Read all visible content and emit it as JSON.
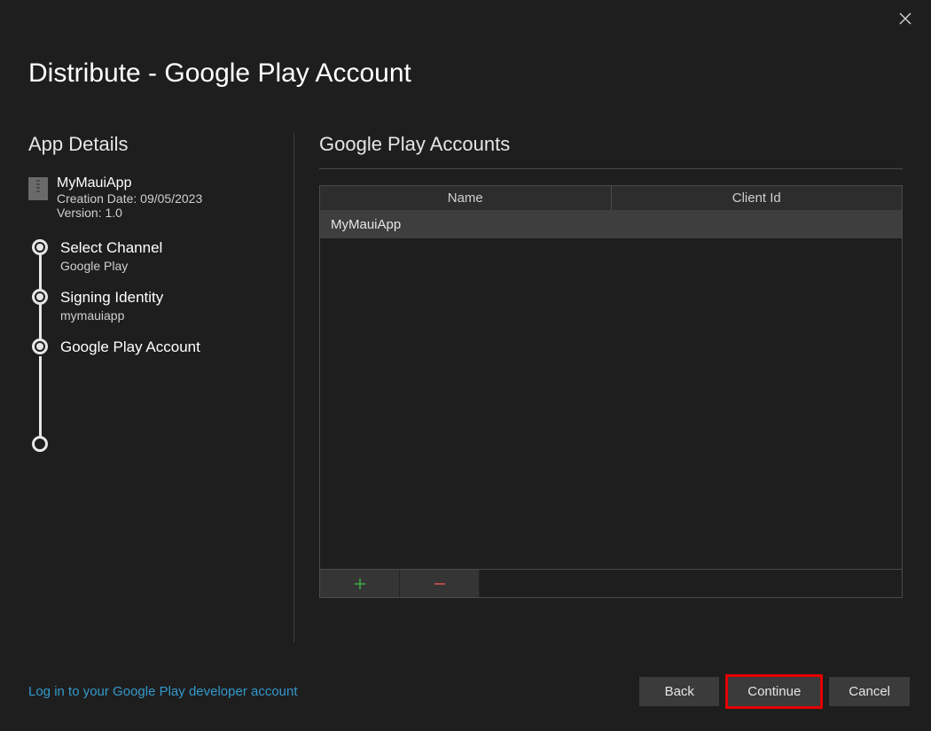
{
  "window": {
    "title": "Distribute - Google Play Account"
  },
  "sidebar": {
    "title": "App Details",
    "app": {
      "name": "MyMauiApp",
      "creation_line": "Creation Date: 09/05/2023",
      "version_line": "Version: 1.0"
    },
    "steps": [
      {
        "label": "Select Channel",
        "sub": "Google Play"
      },
      {
        "label": "Signing Identity",
        "sub": "mymauiapp"
      },
      {
        "label": "Google Play Account",
        "sub": ""
      }
    ]
  },
  "main": {
    "title": "Google Play Accounts",
    "columns": {
      "name": "Name",
      "client_id": "Client Id"
    },
    "rows": [
      {
        "name": "MyMauiApp",
        "client_id": ""
      }
    ]
  },
  "footer": {
    "link": "Log in to your Google Play developer account",
    "back": "Back",
    "continue": "Continue",
    "cancel": "Cancel"
  }
}
